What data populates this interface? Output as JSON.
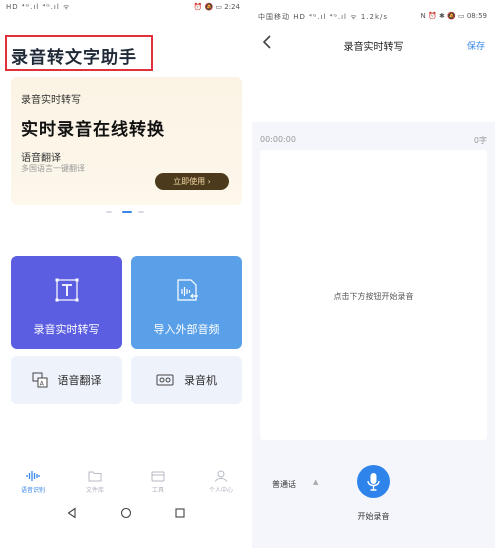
{
  "left": {
    "status": {
      "left_text": "HD ⁴ᴳ.ıl ⁴ᴳ.ıl ᯤ",
      "right_text": "⏰ 🔕 ▭ 2:24"
    },
    "app_title": "录音转文字助手",
    "banner": {
      "subtitle": "录音实时转写",
      "main": "实时录音在线转换",
      "feature": "语音翻译",
      "desc": "多国语言一键翻译",
      "button": "立即使用 ›"
    },
    "cards": {
      "realtime": "录音实时转写",
      "import": "导入外部音频",
      "translate": "语音翻译",
      "recorder": "录音机"
    },
    "nav": {
      "items": [
        "语音识别",
        "文件库",
        "工具",
        "个人中心"
      ],
      "active_index": 0
    }
  },
  "right": {
    "status": {
      "left_text": "中国移动 HD ⁴ᴳ.ıl ⁴ᴳ.ıl ᯤ 1.2k/s",
      "right_text": "N ⏰ ✱ 🔕 ▭ 08:59"
    },
    "title": "录音实时转写",
    "save": "保存",
    "time": "00:00:00",
    "char_count": "0字",
    "hint": "点击下方按钮开始录音",
    "lang": "普通话",
    "start_label": "开始录音"
  },
  "colors": {
    "highlight_box": "#e0313a",
    "accent_blue": "#3a86e8",
    "card_purple": "#5b5ee0",
    "card_blue": "#5aa0e8",
    "banner_button": "#4b3a1c"
  },
  "icons": {
    "card_realtime": "text-frame-icon",
    "card_import": "audio-import-icon",
    "card_translate": "translate-icon",
    "card_recorder": "recorder-icon",
    "nav": [
      "waveform-icon",
      "folder-icon",
      "toolbox-icon",
      "person-icon"
    ],
    "mic": "microphone-icon"
  }
}
